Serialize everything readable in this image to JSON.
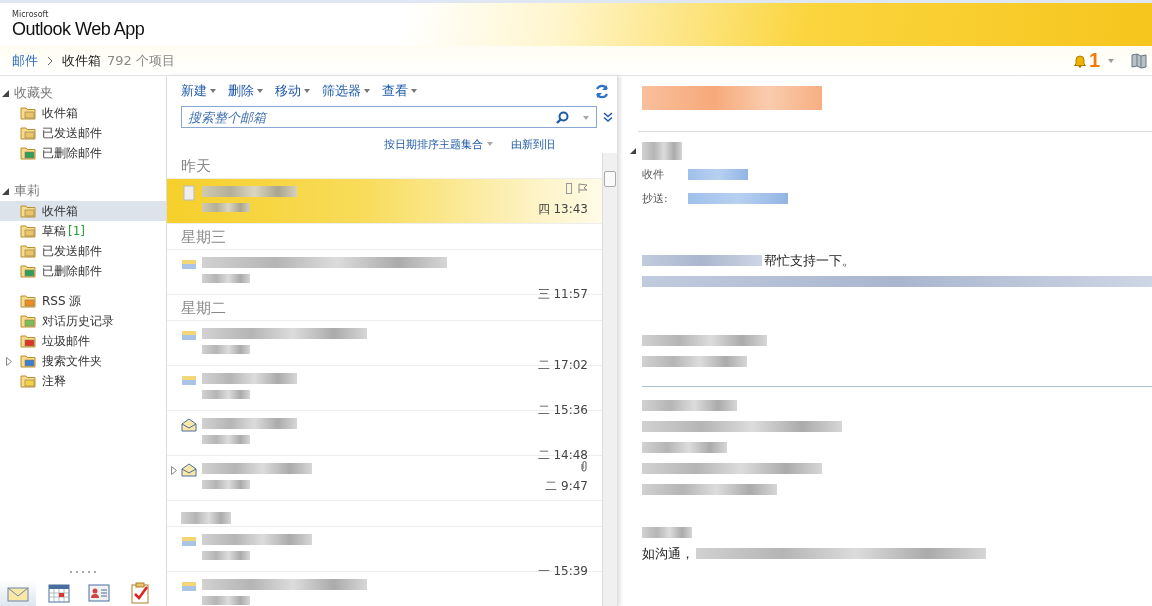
{
  "header": {
    "logo_small": "Microsoft",
    "logo": "Outlook Web App"
  },
  "breadcrumb": {
    "root": "邮件",
    "folder": "收件箱",
    "count": "792 个项目"
  },
  "notifications": {
    "count": "1"
  },
  "nav": {
    "sections": [
      {
        "title": "收藏夹",
        "expanded": true,
        "items": [
          {
            "label": "收件箱",
            "kind": "inbox",
            "selected": false,
            "has_children": false
          },
          {
            "label": "已发送邮件",
            "kind": "sent",
            "selected": false,
            "has_children": false
          },
          {
            "label": "已删除邮件",
            "kind": "deleted",
            "selected": false,
            "has_children": false
          }
        ]
      },
      {
        "title": "車莉",
        "expanded": true,
        "items": [
          {
            "label": "收件箱",
            "kind": "inbox",
            "selected": true,
            "has_children": false
          },
          {
            "label": "草稿",
            "badge": "[1]",
            "kind": "drafts",
            "selected": false,
            "has_children": false
          },
          {
            "label": "已发送邮件",
            "kind": "sent",
            "selected": false,
            "has_children": false
          },
          {
            "label": "已删除邮件",
            "kind": "deleted",
            "selected": false,
            "has_children": false
          }
        ]
      }
    ],
    "extra_items": [
      {
        "label": "RSS 源",
        "kind": "rss",
        "selected": false,
        "has_children": false
      },
      {
        "label": "对话历史记录",
        "kind": "history",
        "selected": false,
        "has_children": false
      },
      {
        "label": "垃圾邮件",
        "kind": "junk",
        "selected": false,
        "has_children": false
      },
      {
        "label": "搜索文件夹",
        "kind": "search",
        "selected": false,
        "has_children": true
      },
      {
        "label": "注释",
        "kind": "notes",
        "selected": false,
        "has_children": false
      }
    ],
    "modules": [
      {
        "kind": "mail",
        "selected": true
      },
      {
        "kind": "calendar",
        "selected": false
      },
      {
        "kind": "contacts",
        "selected": false
      },
      {
        "kind": "tasks",
        "selected": false
      }
    ]
  },
  "toolbar": [
    "新建",
    "删除",
    "移动",
    "筛选器",
    "查看"
  ],
  "search": {
    "placeholder": "搜索整个邮箱"
  },
  "sort": {
    "by": "按日期排序主题集合",
    "order": "由新到旧"
  },
  "groups": [
    {
      "label": "昨天",
      "messages": [
        {
          "time": "四 13:43",
          "selected": true,
          "kind": "draft",
          "attachment": false,
          "thread": false
        }
      ]
    },
    {
      "label": "星期三",
      "messages": [
        {
          "time": "三 11:57",
          "selected": false,
          "kind": "read",
          "attachment": false,
          "thread": false
        }
      ]
    },
    {
      "label": "星期二",
      "messages": [
        {
          "time": "二 17:02",
          "selected": false,
          "kind": "read",
          "attachment": false,
          "thread": false
        },
        {
          "time": "二 15:36",
          "selected": false,
          "kind": "read",
          "attachment": false,
          "thread": false
        },
        {
          "time": "二 14:48",
          "selected": false,
          "kind": "open",
          "attachment": false,
          "thread": false
        },
        {
          "time": "二 9:47",
          "selected": false,
          "kind": "open",
          "attachment": true,
          "thread": true
        }
      ]
    },
    {
      "messages": [
        {
          "time": "一 15:39",
          "selected": false,
          "kind": "read",
          "attachment": false,
          "thread": false
        },
        {
          "selected": false,
          "kind": "read",
          "attachment": false,
          "thread": false
        }
      ]
    }
  ],
  "reading": {
    "to_label": "收件",
    "cc_label": "抄送:",
    "body_line_1_end": "帮忙支持一下。",
    "closing_start": "如沟通，"
  }
}
